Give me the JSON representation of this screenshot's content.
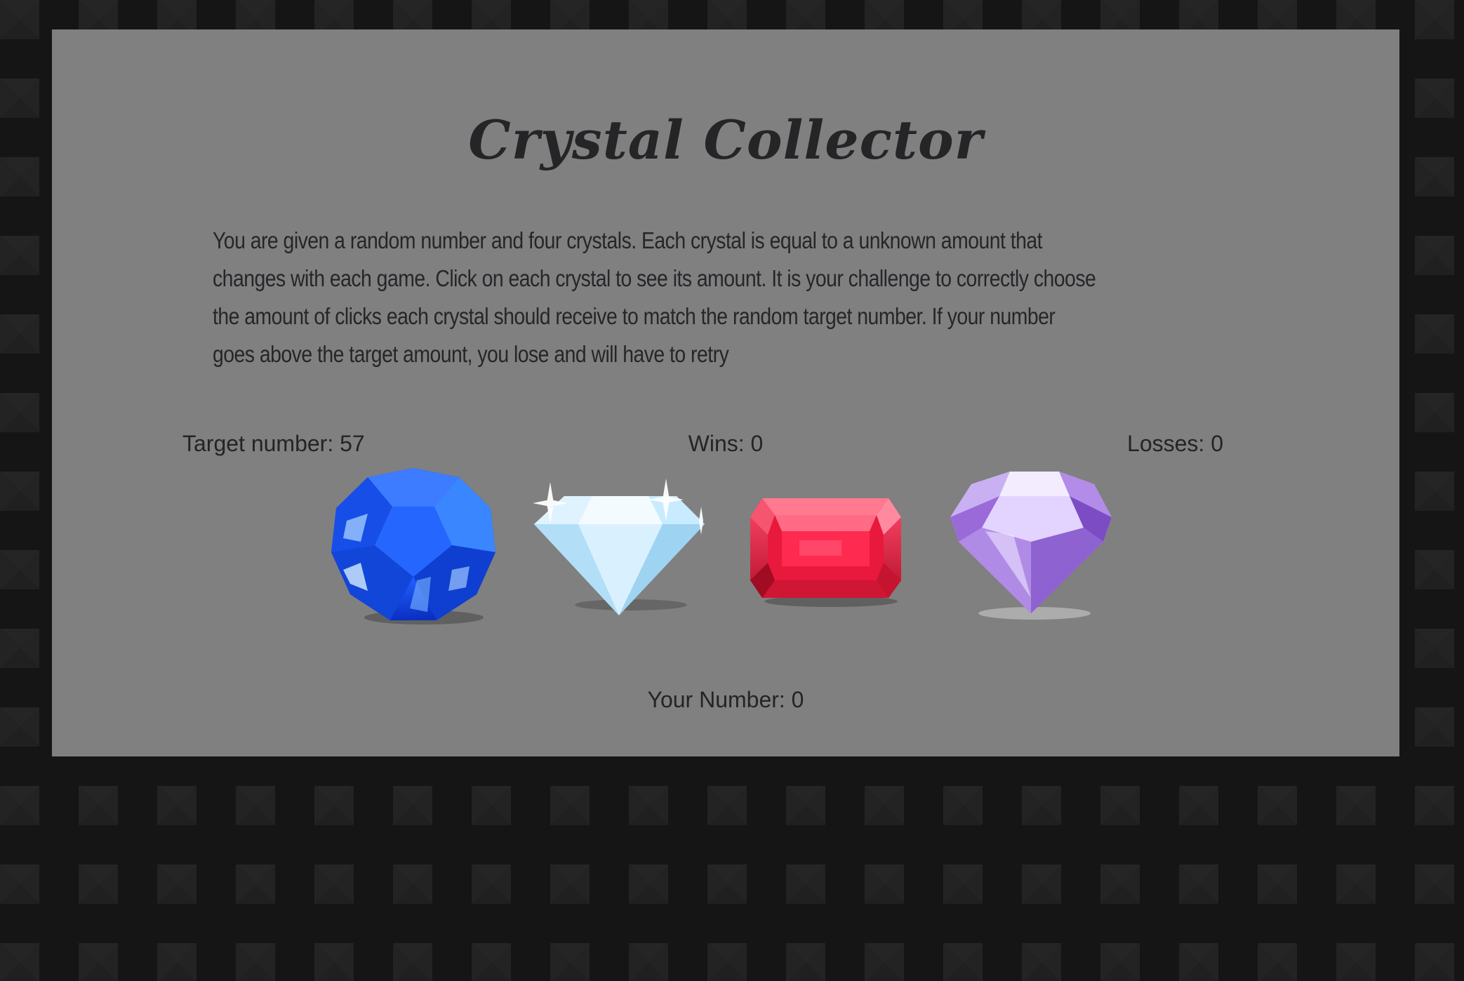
{
  "game": {
    "title": "Crystal Collector",
    "description": "You are given a random number and four crystals. Each crystal is equal to a unknown amount that changes with each game. Click on each crystal to see its amount. It is your challenge to correctly choose the amount of clicks each crystal should receive to match the random target number. If your number goes above the target amount, you lose and will have to retry",
    "target_text": "Target number: 57",
    "wins_text": "Wins: 0",
    "losses_text": "Losses: 0",
    "your_number_text": "Your Number: 0",
    "target_number": 57,
    "wins": 0,
    "losses": 0,
    "your_number": 0
  },
  "crystals": [
    {
      "name": "blue-sapphire-crystal",
      "color": "#1f5fff"
    },
    {
      "name": "clear-diamond-crystal",
      "color": "#bfe8ff"
    },
    {
      "name": "red-ruby-crystal",
      "color": "#e8193c"
    },
    {
      "name": "purple-amethyst-crystal",
      "color": "#a070e0"
    }
  ],
  "colors": {
    "panel": "#808080",
    "page_background": "#151515",
    "text": "#252527"
  }
}
